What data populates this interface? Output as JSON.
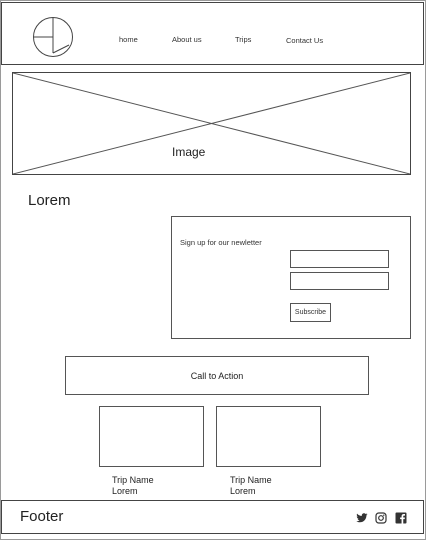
{
  "nav": {
    "items": [
      {
        "label": "home"
      },
      {
        "label": "About us"
      },
      {
        "label": "Trips"
      },
      {
        "label": "Contact Us"
      }
    ]
  },
  "hero": {
    "label": "Image"
  },
  "main": {
    "heading": "Lorem"
  },
  "newsletter": {
    "label": "Sign up for our newletter",
    "field1_value": "",
    "field2_value": "",
    "subscribe_label": "Subscribe"
  },
  "cta": {
    "label": "Call to Action"
  },
  "trips": [
    {
      "name": "Trip Name",
      "description": "Lorem"
    },
    {
      "name": "Trip Name",
      "description": "Lorem"
    }
  ],
  "footer": {
    "label": "Footer",
    "social": [
      {
        "icon": "twitter-icon"
      },
      {
        "icon": "instagram-icon"
      },
      {
        "icon": "facebook-icon"
      }
    ]
  },
  "colors": {
    "border": "#555555",
    "text": "#222222",
    "icon": "#333333"
  }
}
